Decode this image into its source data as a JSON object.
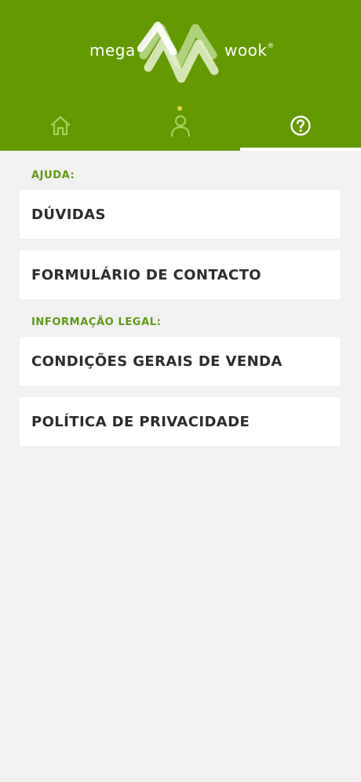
{
  "brand": {
    "word_left": "mega",
    "word_right": "wook",
    "registered": "®"
  },
  "tabs": [
    {
      "icon": "home-icon",
      "active": false
    },
    {
      "icon": "user-icon",
      "active": false,
      "notification": true
    },
    {
      "icon": "help-icon",
      "active": true
    }
  ],
  "colors": {
    "header": "#639a00",
    "label": "#5f9a12",
    "background": "#f1f1f1",
    "card": "#ffffff",
    "notification_dot": "#d9d43a"
  },
  "sections": [
    {
      "label": "AJUDA:",
      "items": [
        "DÚVIDAS",
        "FORMULÁRIO DE CONTACTO"
      ]
    },
    {
      "label": "INFORMAÇÃO LEGAL:",
      "items": [
        "CONDIÇÕES GERAIS DE VENDA",
        "POLÍTICA DE PRIVACIDADE"
      ]
    }
  ]
}
